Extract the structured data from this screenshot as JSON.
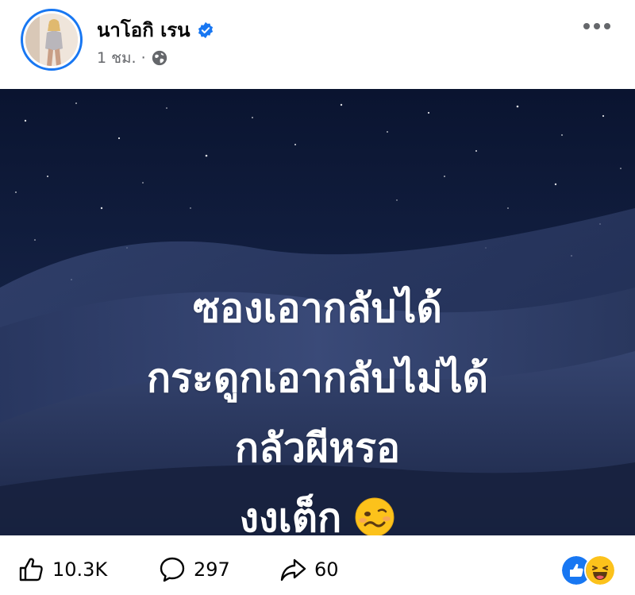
{
  "post": {
    "author": "นาโอกิ เรน",
    "time": "1 ชม.",
    "separator": "·",
    "text_lines": [
      "ซองเอากลับได้",
      "กระดูกเอากลับไม่ได้",
      "กลัวผีหรอ",
      "งงเต็ก"
    ],
    "text_emoji": "woozy-face"
  },
  "actions": {
    "likes": "10.3K",
    "comments": "297",
    "shares": "60"
  },
  "reactions": [
    "like",
    "haha"
  ],
  "colors": {
    "accent": "#1877f2",
    "sky_top": "#0b1730",
    "sky_bottom": "#1a2a52",
    "dune": "#2c3a63"
  }
}
